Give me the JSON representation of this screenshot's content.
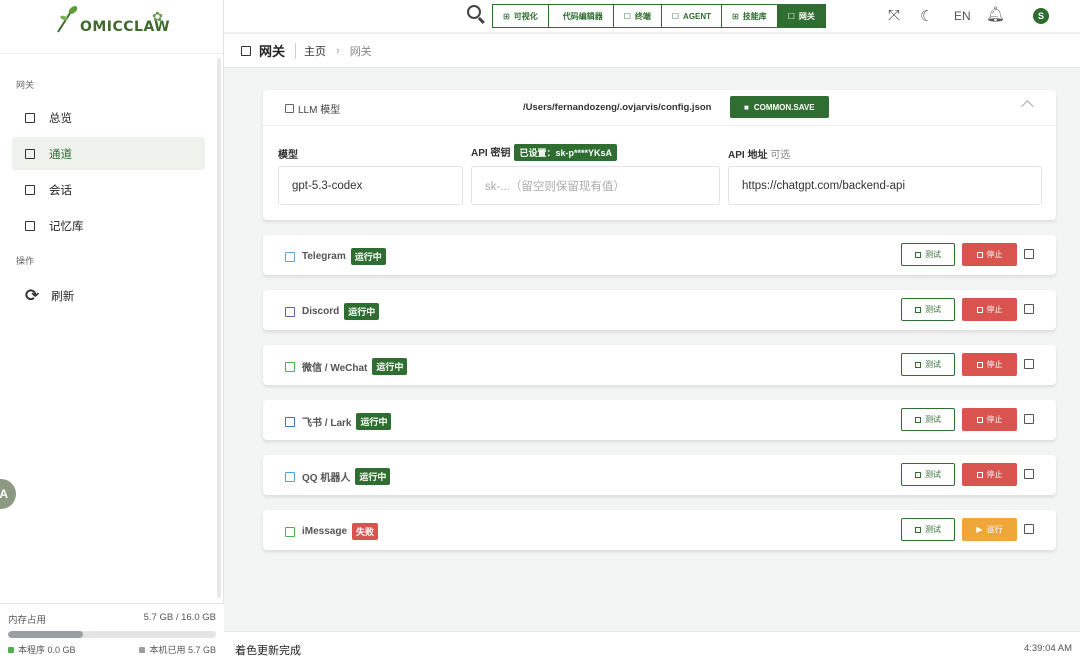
{
  "app": {
    "logo_text": "OMICCLAW"
  },
  "sidebar": {
    "section_gateway": "网关",
    "items": [
      {
        "label": "总览",
        "active": false
      },
      {
        "label": "通道",
        "active": true
      },
      {
        "label": "会话",
        "active": false
      },
      {
        "label": "记忆库",
        "active": false
      }
    ],
    "section_ops": "操作",
    "refresh_label": "刷新",
    "side_avatar": "A"
  },
  "memory": {
    "label": "内存占用",
    "value": "5.7 GB / 16.0 GB",
    "fill_fraction": 0.36,
    "app_used": "本程序 0.0 GB",
    "system_used": "本机已用 5.7 GB",
    "app_color": "#4caf50",
    "system_color": "#9aa0a2"
  },
  "topbar": {
    "tabs": [
      {
        "label": "可视化",
        "icon": "chart-icon",
        "active": false
      },
      {
        "label": "代码编辑器",
        "icon": "code-icon",
        "active": false
      },
      {
        "label": "终端",
        "icon": "terminal-icon",
        "active": false
      },
      {
        "label": "AGENT",
        "icon": "agent-icon",
        "active": false
      },
      {
        "label": "技能库",
        "icon": "grid-icon",
        "active": false
      },
      {
        "label": "网关",
        "icon": "gateway-icon",
        "active": true
      }
    ],
    "lang": "EN",
    "user_initial": "S"
  },
  "breadcrumb": {
    "title": "网关",
    "home": "主页",
    "current": "网关"
  },
  "llm": {
    "title": "LLM 模型",
    "config_path": "/Users/fernandozeng/.ovjarvis/config.json",
    "save_label": "COMMON.SAVE",
    "model_label": "模型",
    "model_value": "gpt-5.3-codex",
    "key_label": "API 密钥",
    "key_badge": "已设置：sk-p****YKsA",
    "key_placeholder": "sk-...（留空则保留现有值）",
    "url_label": "API 地址",
    "url_optional": "可选",
    "url_value": "https://chatgpt.com/backend-api"
  },
  "channels": [
    {
      "name": "Telegram",
      "status": "运行中",
      "ok": true,
      "color": "#5ba3d9",
      "test": "测试",
      "action": "停止"
    },
    {
      "name": "Discord",
      "status": "运行中",
      "ok": true,
      "color": "#5865a8",
      "test": "测试",
      "action": "停止"
    },
    {
      "name": "微信 / WeChat",
      "status": "运行中",
      "ok": true,
      "color": "#4caf50",
      "test": "测试",
      "action": "停止"
    },
    {
      "name": "飞书 / Lark",
      "status": "运行中",
      "ok": true,
      "color": "#3b6fd6",
      "test": "测试",
      "action": "停止"
    },
    {
      "name": "QQ 机器人",
      "status": "运行中",
      "ok": true,
      "color": "#4aa3e0",
      "test": "测试",
      "action": "停止"
    },
    {
      "name": "iMessage",
      "status": "失败",
      "ok": false,
      "color": "#4caf50",
      "test": "测试",
      "action": "运行"
    }
  ],
  "statusbar": {
    "message": "着色更新完成",
    "time": "4:39:04 AM"
  },
  "colors": {
    "accent": "#2f6d31",
    "danger": "#d9534f",
    "warning": "#f0a73a"
  }
}
